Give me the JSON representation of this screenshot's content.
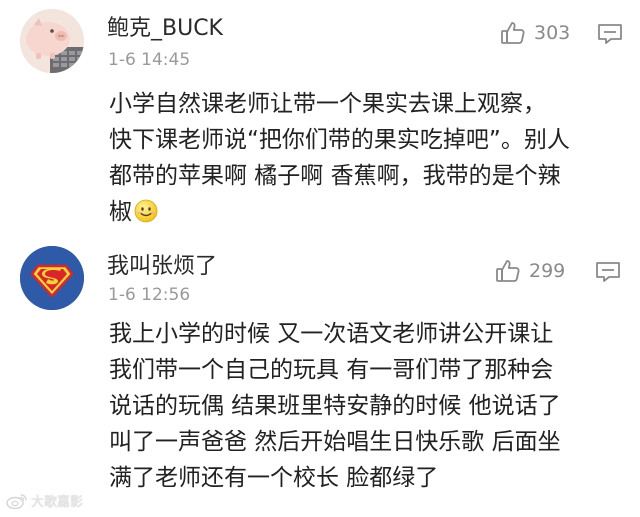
{
  "comments": [
    {
      "username": "鲍克_BUCK",
      "time": "1-6 14:45",
      "likes": "303",
      "avatar_icon": "piggy-bank-avatar",
      "text_lines": [
        "小学自然课老师让带一个果实去课上观察，",
        "快下课老师说“把你们带的果实吃掉吧”。别人",
        "都带的苹果啊 橘子啊 香蕉啊，我带的是个辣",
        "椒"
      ],
      "emoji": "smile-emoji"
    },
    {
      "username": "我叫张烦了",
      "time": "1-6 12:56",
      "likes": "299",
      "avatar_icon": "superman-logo-avatar",
      "text_lines": [
        "我上小学的时候 又一次语文老师讲公开课让",
        "我们带一个自己的玩具 有一哥们带了那种会",
        "说话的玩偶 结果班里特安静的时候 他说话了",
        "叫了一声爸爸 然后开始唱生日快乐歌 后面坐",
        "满了老师还有一个校长 脸都绿了"
      ]
    }
  ],
  "icons": {
    "like": "thumbs-up-icon",
    "reply": "comment-icon"
  },
  "watermark": {
    "text": "大歌嘉影"
  },
  "colors": {
    "text": "#222222",
    "meta": "#9a9a9a",
    "icon": "#8a8a8a",
    "superman_blue": "#2e5aa8",
    "superman_red": "#d8262b",
    "superman_yellow": "#f3d23a"
  }
}
